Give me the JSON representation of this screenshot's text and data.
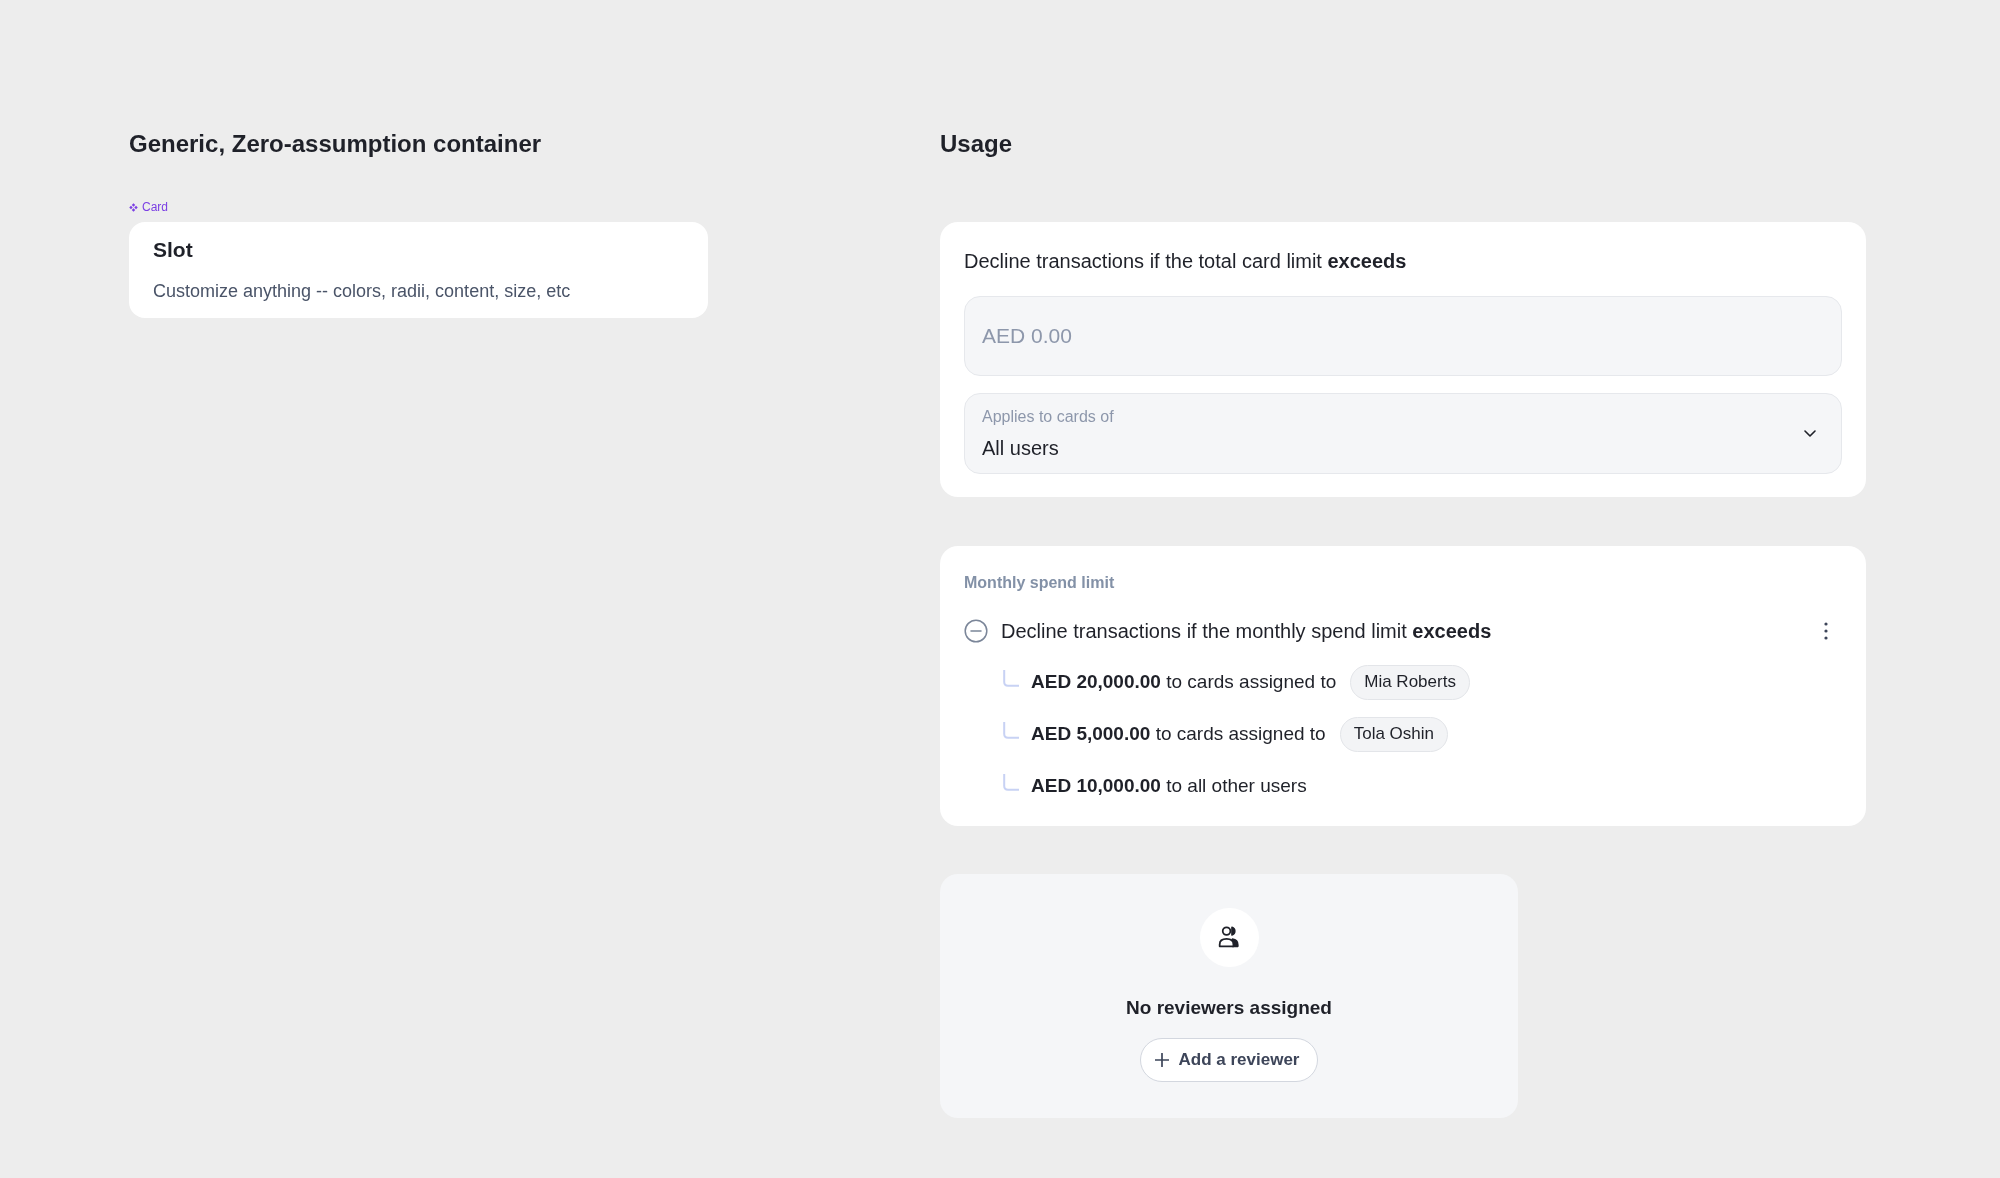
{
  "component_demo": {
    "title": "Generic, Zero-assumption container",
    "component_tag": "Card",
    "card": {
      "title": "Slot",
      "description": "Customize anything -- colors, radii, content, size, etc"
    }
  },
  "usage": {
    "title": "Usage",
    "total_limit": {
      "prompt": "Decline transactions if the total card limit **exceeds**",
      "amount_field": {
        "placeholder": "AED 0.00"
      },
      "applies_select": {
        "label": "Applies to cards of",
        "value": "All users"
      }
    },
    "monthly_limit": {
      "heading": "Monthly spend limit",
      "rule": "Decline transactions if the monthly spend limit **exceeds**",
      "limits": [
        {
          "text": "**AED 20,000.00** to cards assigned to",
          "assignee": "Mia Roberts"
        },
        {
          "text": "**AED 5,000.00** to cards assigned to",
          "assignee": "Tola Oshin"
        },
        {
          "text": "**AED 10,000.00** to all other users"
        }
      ]
    },
    "reviewers": {
      "empty_message": "No reviewers assigned",
      "button": "Add a reviewer"
    }
  }
}
